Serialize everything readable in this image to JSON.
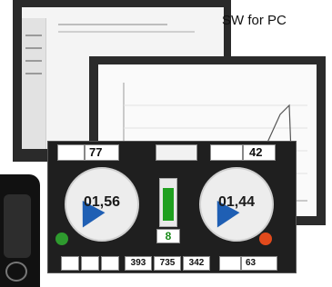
{
  "sw_label": "SW for PC",
  "display": {
    "left_top_value": "77",
    "right_top_value": "42",
    "left_gauge_value": "01,56",
    "right_gauge_value": "01,44",
    "center_value": "8",
    "bottom_values": [
      "393",
      "735",
      "342"
    ],
    "percent_value": "63"
  },
  "colors": {
    "gauge_needle": "#1f5fb4",
    "left_status": "#2e9a2e",
    "right_status": "#e24a1c",
    "center_value": "#1a8a1a"
  }
}
